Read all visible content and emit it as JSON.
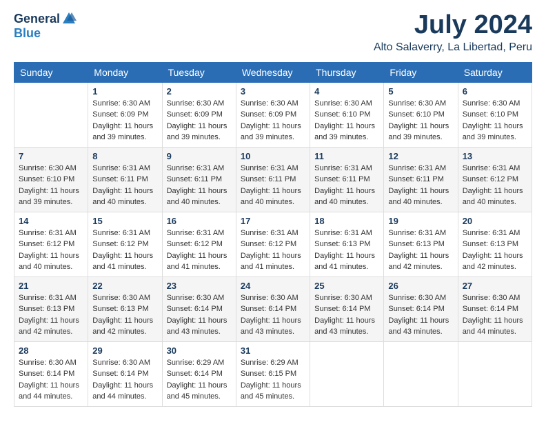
{
  "header": {
    "logo_general": "General",
    "logo_blue": "Blue",
    "title": "July 2024",
    "location": "Alto Salaverry, La Libertad, Peru"
  },
  "calendar": {
    "days_of_week": [
      "Sunday",
      "Monday",
      "Tuesday",
      "Wednesday",
      "Thursday",
      "Friday",
      "Saturday"
    ],
    "weeks": [
      [
        {
          "day": "",
          "info": ""
        },
        {
          "day": "1",
          "info": "Sunrise: 6:30 AM\nSunset: 6:09 PM\nDaylight: 11 hours\nand 39 minutes."
        },
        {
          "day": "2",
          "info": "Sunrise: 6:30 AM\nSunset: 6:09 PM\nDaylight: 11 hours\nand 39 minutes."
        },
        {
          "day": "3",
          "info": "Sunrise: 6:30 AM\nSunset: 6:09 PM\nDaylight: 11 hours\nand 39 minutes."
        },
        {
          "day": "4",
          "info": "Sunrise: 6:30 AM\nSunset: 6:10 PM\nDaylight: 11 hours\nand 39 minutes."
        },
        {
          "day": "5",
          "info": "Sunrise: 6:30 AM\nSunset: 6:10 PM\nDaylight: 11 hours\nand 39 minutes."
        },
        {
          "day": "6",
          "info": "Sunrise: 6:30 AM\nSunset: 6:10 PM\nDaylight: 11 hours\nand 39 minutes."
        }
      ],
      [
        {
          "day": "7",
          "info": "Sunrise: 6:30 AM\nSunset: 6:10 PM\nDaylight: 11 hours\nand 39 minutes."
        },
        {
          "day": "8",
          "info": "Sunrise: 6:31 AM\nSunset: 6:11 PM\nDaylight: 11 hours\nand 40 minutes."
        },
        {
          "day": "9",
          "info": "Sunrise: 6:31 AM\nSunset: 6:11 PM\nDaylight: 11 hours\nand 40 minutes."
        },
        {
          "day": "10",
          "info": "Sunrise: 6:31 AM\nSunset: 6:11 PM\nDaylight: 11 hours\nand 40 minutes."
        },
        {
          "day": "11",
          "info": "Sunrise: 6:31 AM\nSunset: 6:11 PM\nDaylight: 11 hours\nand 40 minutes."
        },
        {
          "day": "12",
          "info": "Sunrise: 6:31 AM\nSunset: 6:11 PM\nDaylight: 11 hours\nand 40 minutes."
        },
        {
          "day": "13",
          "info": "Sunrise: 6:31 AM\nSunset: 6:12 PM\nDaylight: 11 hours\nand 40 minutes."
        }
      ],
      [
        {
          "day": "14",
          "info": "Sunrise: 6:31 AM\nSunset: 6:12 PM\nDaylight: 11 hours\nand 40 minutes."
        },
        {
          "day": "15",
          "info": "Sunrise: 6:31 AM\nSunset: 6:12 PM\nDaylight: 11 hours\nand 41 minutes."
        },
        {
          "day": "16",
          "info": "Sunrise: 6:31 AM\nSunset: 6:12 PM\nDaylight: 11 hours\nand 41 minutes."
        },
        {
          "day": "17",
          "info": "Sunrise: 6:31 AM\nSunset: 6:12 PM\nDaylight: 11 hours\nand 41 minutes."
        },
        {
          "day": "18",
          "info": "Sunrise: 6:31 AM\nSunset: 6:13 PM\nDaylight: 11 hours\nand 41 minutes."
        },
        {
          "day": "19",
          "info": "Sunrise: 6:31 AM\nSunset: 6:13 PM\nDaylight: 11 hours\nand 42 minutes."
        },
        {
          "day": "20",
          "info": "Sunrise: 6:31 AM\nSunset: 6:13 PM\nDaylight: 11 hours\nand 42 minutes."
        }
      ],
      [
        {
          "day": "21",
          "info": "Sunrise: 6:31 AM\nSunset: 6:13 PM\nDaylight: 11 hours\nand 42 minutes."
        },
        {
          "day": "22",
          "info": "Sunrise: 6:30 AM\nSunset: 6:13 PM\nDaylight: 11 hours\nand 42 minutes."
        },
        {
          "day": "23",
          "info": "Sunrise: 6:30 AM\nSunset: 6:14 PM\nDaylight: 11 hours\nand 43 minutes."
        },
        {
          "day": "24",
          "info": "Sunrise: 6:30 AM\nSunset: 6:14 PM\nDaylight: 11 hours\nand 43 minutes."
        },
        {
          "day": "25",
          "info": "Sunrise: 6:30 AM\nSunset: 6:14 PM\nDaylight: 11 hours\nand 43 minutes."
        },
        {
          "day": "26",
          "info": "Sunrise: 6:30 AM\nSunset: 6:14 PM\nDaylight: 11 hours\nand 43 minutes."
        },
        {
          "day": "27",
          "info": "Sunrise: 6:30 AM\nSunset: 6:14 PM\nDaylight: 11 hours\nand 44 minutes."
        }
      ],
      [
        {
          "day": "28",
          "info": "Sunrise: 6:30 AM\nSunset: 6:14 PM\nDaylight: 11 hours\nand 44 minutes."
        },
        {
          "day": "29",
          "info": "Sunrise: 6:30 AM\nSunset: 6:14 PM\nDaylight: 11 hours\nand 44 minutes."
        },
        {
          "day": "30",
          "info": "Sunrise: 6:29 AM\nSunset: 6:14 PM\nDaylight: 11 hours\nand 45 minutes."
        },
        {
          "day": "31",
          "info": "Sunrise: 6:29 AM\nSunset: 6:15 PM\nDaylight: 11 hours\nand 45 minutes."
        },
        {
          "day": "",
          "info": ""
        },
        {
          "day": "",
          "info": ""
        },
        {
          "day": "",
          "info": ""
        }
      ]
    ]
  }
}
